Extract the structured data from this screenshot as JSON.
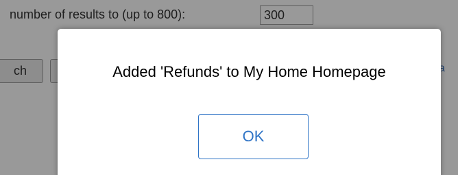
{
  "page": {
    "results_label": "number of results to (up to 800):",
    "results_value": "300",
    "search_button_label": "ch",
    "link_fragment": "a"
  },
  "dialog": {
    "message": "Added 'Refunds' to My Home Homepage",
    "ok_label": "OK"
  },
  "colors": {
    "accent": "#2f74c6",
    "overlay": "rgba(0,0,0,0.4)"
  }
}
